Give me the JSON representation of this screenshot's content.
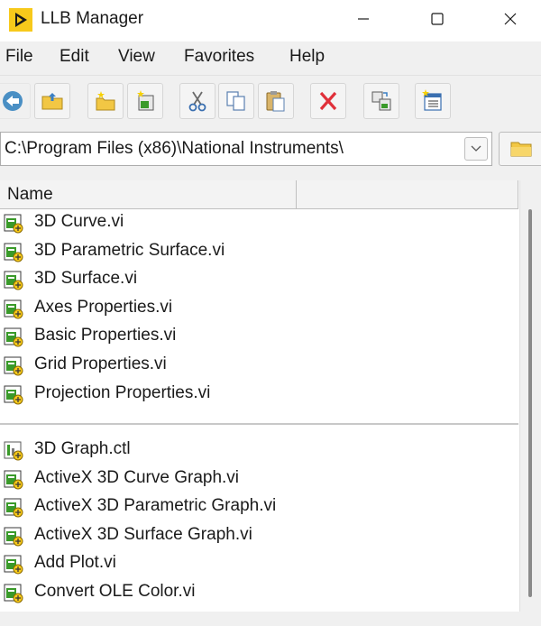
{
  "window": {
    "title": "LLB Manager",
    "minimize_glyph": "—",
    "maximize_glyph": "☐",
    "close_glyph": "✕"
  },
  "menu": {
    "items": [
      {
        "label": "File"
      },
      {
        "label": "Edit"
      },
      {
        "label": "View"
      },
      {
        "label": "Favorites"
      },
      {
        "label": "Help"
      }
    ]
  },
  "toolbar": {
    "buttons": [
      "back-icon",
      "up-folder-icon",
      "new-llb-icon",
      "new-vi-icon",
      "cut-icon",
      "copy-icon",
      "paste-icon",
      "delete-icon",
      "convert-icon",
      "properties-icon"
    ]
  },
  "path": {
    "value": "C:\\Program Files (x86)\\National Instruments\\"
  },
  "list": {
    "column_name": "Name",
    "top_items": [
      {
        "label": "3D Curve.vi"
      },
      {
        "label": "3D Parametric Surface.vi"
      },
      {
        "label": "3D Surface.vi"
      },
      {
        "label": "Axes Properties.vi"
      },
      {
        "label": "Basic Properties.vi"
      },
      {
        "label": "Grid Properties.vi"
      },
      {
        "label": "Projection Properties.vi"
      }
    ],
    "bottom_items": [
      {
        "label": "3D Graph.ctl"
      },
      {
        "label": "ActiveX 3D Curve Graph.vi"
      },
      {
        "label": "ActiveX 3D Parametric Graph.vi"
      },
      {
        "label": "ActiveX 3D Surface Graph.vi"
      },
      {
        "label": "Add Plot.vi"
      },
      {
        "label": "Convert OLE Color.vi"
      }
    ]
  },
  "colors": {
    "labview_yellow": "#f7c91b",
    "vi_green": "#3a9a2a",
    "delete_red": "#e0303a"
  }
}
